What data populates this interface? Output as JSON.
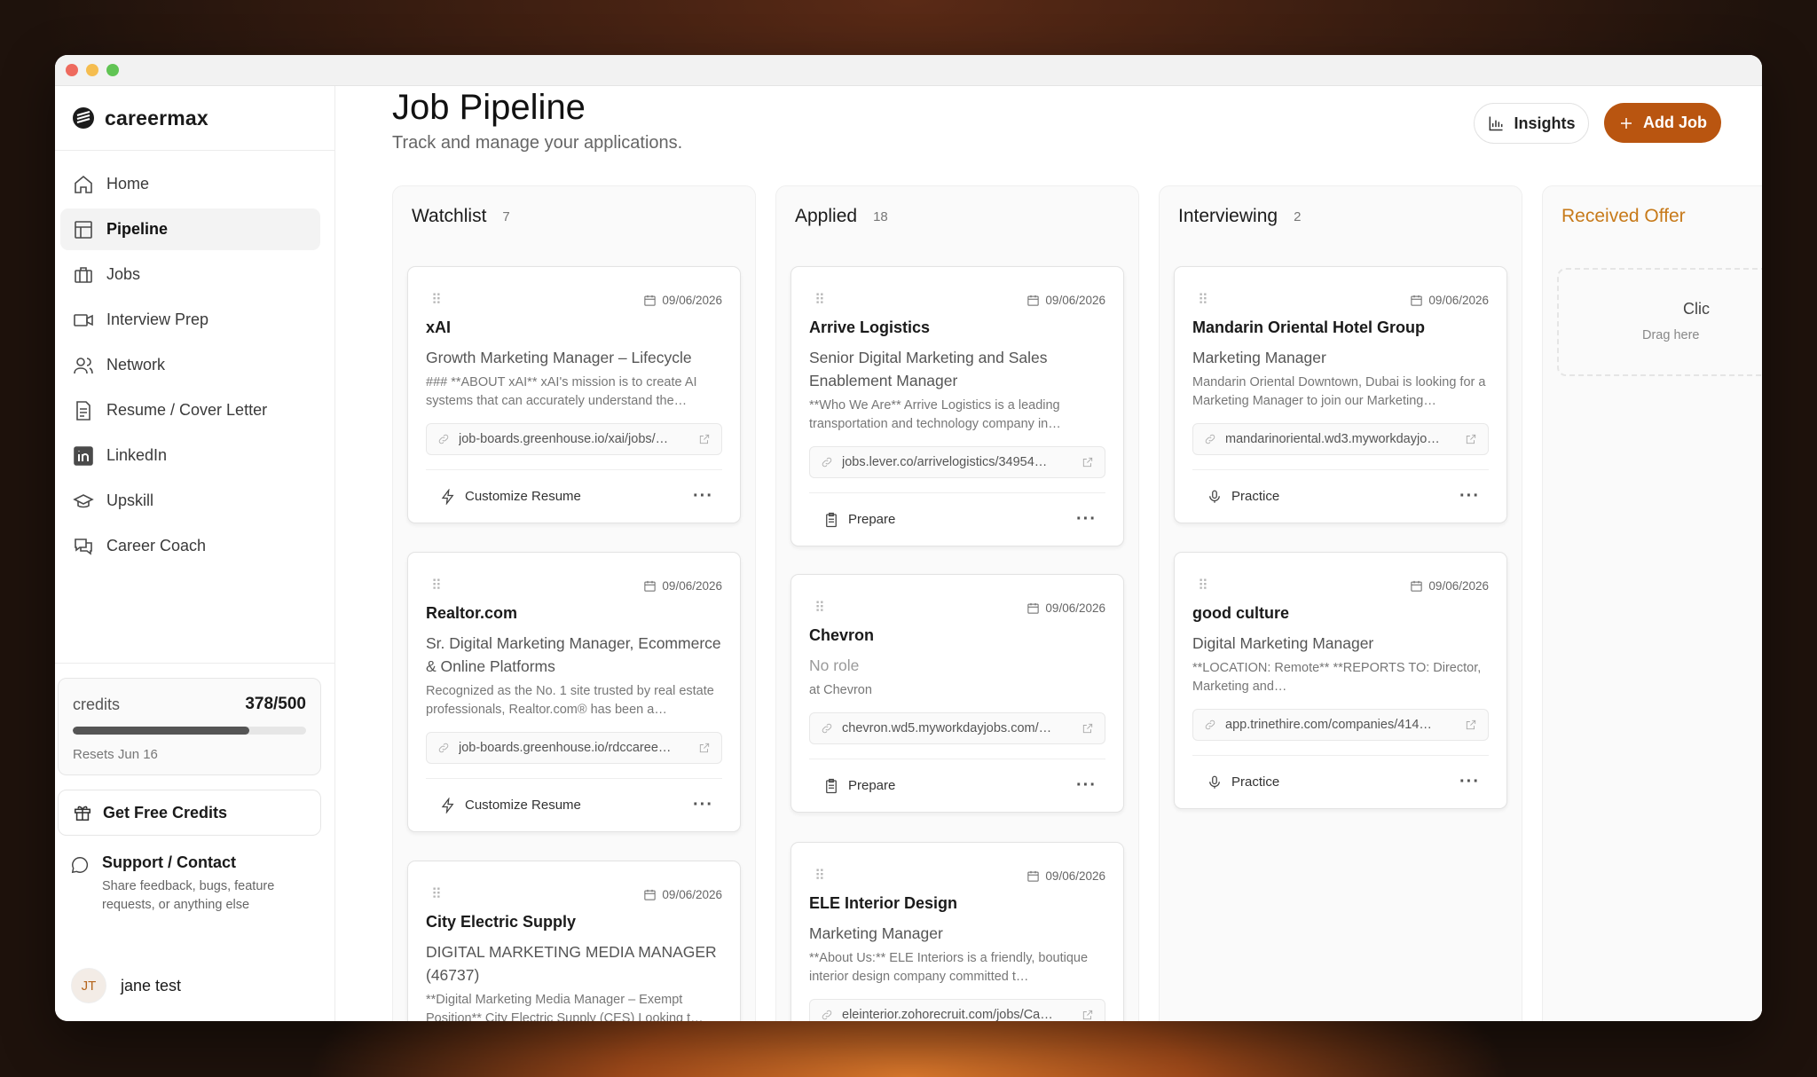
{
  "brand": {
    "name": "careermax"
  },
  "nav": [
    {
      "label": "Home",
      "icon": "home-icon"
    },
    {
      "label": "Pipeline",
      "icon": "pipeline-icon",
      "active": true
    },
    {
      "label": "Jobs",
      "icon": "briefcase-icon"
    },
    {
      "label": "Interview Prep",
      "icon": "video-icon"
    },
    {
      "label": "Network",
      "icon": "users-icon"
    },
    {
      "label": "Resume / Cover Letter",
      "icon": "document-icon"
    },
    {
      "label": "LinkedIn",
      "icon": "linkedin-icon"
    },
    {
      "label": "Upskill",
      "icon": "graduation-icon"
    },
    {
      "label": "Career Coach",
      "icon": "chat-icon"
    }
  ],
  "credits": {
    "label": "credits",
    "value": "378/500",
    "used_fraction": 0.756,
    "reset": "Resets Jun 16"
  },
  "free_credits": {
    "label": "Get Free Credits"
  },
  "support": {
    "title": "Support / Contact",
    "desc": "Share feedback, bugs, feature requests, or anything else"
  },
  "user": {
    "initials": "JT",
    "name": "jane test"
  },
  "header": {
    "title": "Job Pipeline",
    "subtitle": "Track and manage your applications.",
    "insights": "Insights",
    "add_job": "Add Job"
  },
  "columns": {
    "watchlist": {
      "title": "Watchlist",
      "count": "7"
    },
    "applied": {
      "title": "Applied",
      "count": "18"
    },
    "interviewing": {
      "title": "Interviewing",
      "count": "2"
    },
    "offer": {
      "title": "Received Offer",
      "drop_title": "Clic",
      "drop_sub": "Drag here"
    }
  },
  "cards": {
    "w1": {
      "date": "09/06/2026",
      "company": "xAI",
      "role": "Growth Marketing Manager – Lifecycle",
      "desc": "### **ABOUT xAI** xAI's mission is to create AI systems that can accurately understand the…",
      "url": "job-boards.greenhouse.io/xai/jobs/…",
      "action": "Customize Resume"
    },
    "w2": {
      "date": "09/06/2026",
      "company": "Realtor.com",
      "role": "Sr. Digital Marketing Manager, Ecommerce & Online Platforms",
      "desc": "Recognized as the No. 1 site trusted by real estate professionals, Realtor.com® has been a…",
      "url": "job-boards.greenhouse.io/rdccaree…",
      "action": "Customize Resume"
    },
    "w3": {
      "date": "09/06/2026",
      "company": "City Electric Supply",
      "role": "DIGITAL MARKETING MEDIA MANAGER (46737)",
      "desc": "**Digital Marketing Media Manager – Exempt Position** City Electric Supply (CES) Looking t…"
    },
    "a1": {
      "date": "09/06/2026",
      "company": "Arrive Logistics",
      "role": "Senior Digital Marketing and Sales Enablement Manager",
      "desc": "**Who We Are** Arrive Logistics is a leading transportation and technology company in…",
      "url": "jobs.lever.co/arrivelogistics/34954…",
      "action": "Prepare"
    },
    "a2": {
      "date": "09/06/2026",
      "company": "Chevron",
      "role": "No role",
      "desc": "at Chevron",
      "url": "chevron.wd5.myworkdayjobs.com/…",
      "action": "Prepare"
    },
    "a3": {
      "date": "09/06/2026",
      "company": "ELE Interior Design",
      "role": "Marketing Manager",
      "desc": "**About Us:** ELE Interiors is a friendly, boutique interior design company committed t…",
      "url": "eleinterior.zohorecruit.com/jobs/Ca…"
    },
    "i1": {
      "date": "09/06/2026",
      "company": "Mandarin Oriental Hotel Group",
      "role": "Marketing Manager",
      "desc": "Mandarin Oriental Downtown, Dubai is looking for a Marketing Manager to join our Marketing…",
      "url": "mandarinoriental.wd3.myworkdayjo…",
      "action": "Practice"
    },
    "i2": {
      "date": "09/06/2026",
      "company": "good culture",
      "role": "Digital Marketing Manager",
      "desc": "**LOCATION: Remote** **REPORTS TO: Director, Marketing and…",
      "url": "app.trinethire.com/companies/414…",
      "action": "Practice"
    }
  },
  "colors": {
    "accent": "#b95510",
    "offer_title": "#c77a1a"
  }
}
